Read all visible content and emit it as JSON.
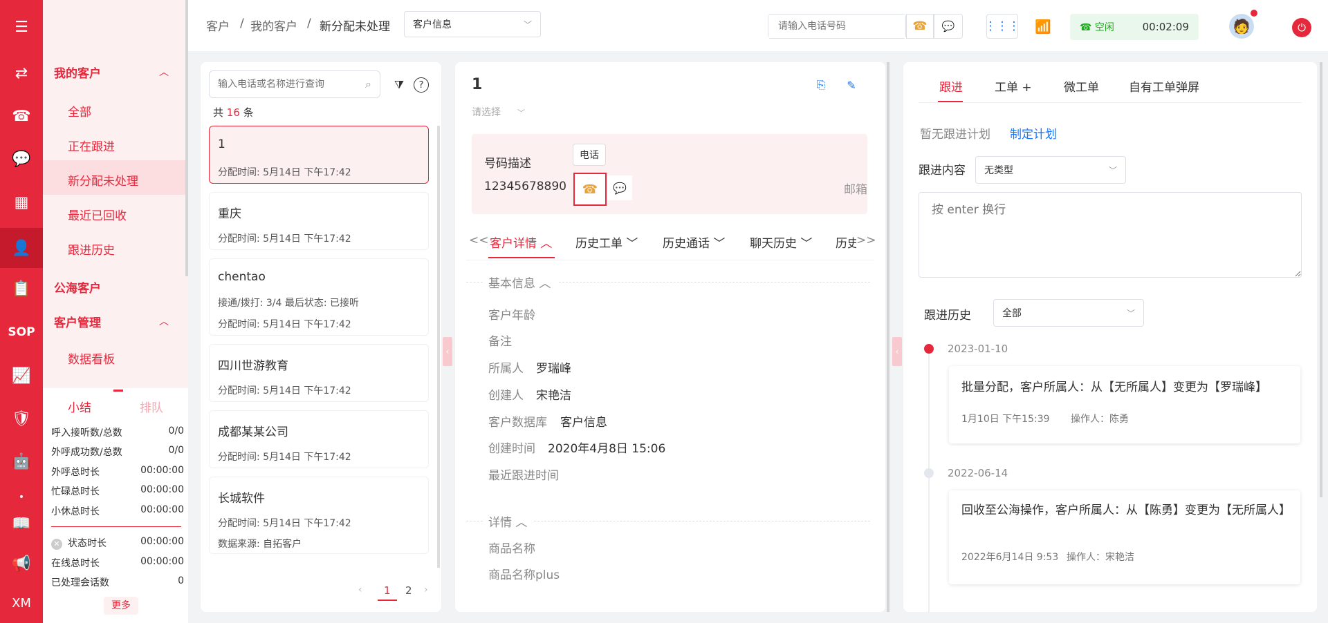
{
  "rail": {
    "items": [
      "menu-icon",
      "transfer-icon",
      "phone-icon",
      "chat-icon",
      "grid-icon",
      "user-icon",
      "clipboard-icon",
      "SOP",
      "monitor-icon",
      "shield-icon",
      "robot-icon",
      "dot",
      "book-icon",
      "megaphone-icon",
      "XM"
    ]
  },
  "sidebar": {
    "my_customers": "我的客户",
    "items": [
      "全部",
      "正在跟进",
      "新分配未处理",
      "最近已回收",
      "跟进历史"
    ],
    "public_customers": "公海客户",
    "customer_mgmt": "客户管理",
    "mgmt_items": [
      "数据看板"
    ]
  },
  "stats": {
    "tab_summary": "小结",
    "tab_queue": "排队",
    "rows": [
      [
        "呼入接听数/总数",
        "0/0"
      ],
      [
        "外呼成功数/总数",
        "0/0"
      ],
      [
        "外呼总时长",
        "00:00:00"
      ],
      [
        "忙碌总时长",
        "00:00:00"
      ],
      [
        "小休总时长",
        "00:00:00"
      ],
      [
        "状态时长",
        "00:00:00"
      ],
      [
        "在线总时长",
        "00:00:00"
      ],
      [
        "已处理会话数",
        "0"
      ]
    ],
    "more": "更多"
  },
  "header": {
    "crumbs": [
      "客户",
      "我的客户",
      "新分配未处理"
    ],
    "sep": "/",
    "db_select": "客户信息",
    "phone_placeholder": "请输入电话号码",
    "status": "空闲",
    "timer": "00:02:09"
  },
  "list": {
    "search_placeholder": "输入电话或名称进行查询",
    "total_prefix": "共",
    "total": "16",
    "total_suffix": "条",
    "cards": [
      {
        "title": "1",
        "metas": [
          "分配时间:  5月14日 下午17:42"
        ]
      },
      {
        "title": "重庆",
        "metas": [
          "分配时间:  5月14日 下午17:42"
        ]
      },
      {
        "title": "chentao",
        "metas": [
          "接通/拨打:  3/4    最后状态:  已接听",
          "分配时间:  5月14日 下午17:42"
        ]
      },
      {
        "title": "四川世游教育",
        "metas": [
          "分配时间:  5月14日 下午17:42"
        ]
      },
      {
        "title": "成都某某公司",
        "metas": [
          "分配时间:  5月14日 下午17:42"
        ]
      },
      {
        "title": "长城软件",
        "metas": [
          "分配时间:  5月14日 下午17:42",
          "数据来源:  自拓客户"
        ]
      }
    ],
    "pages": [
      "1",
      "2"
    ]
  },
  "detail": {
    "name": "1",
    "select_placeholder": "请选择",
    "phone_desc_label": "号码描述",
    "phone": "12345678890",
    "tooltip": "电话",
    "email_label": "邮箱",
    "tabs": [
      "客户详情",
      "历史工单",
      "历史通话",
      "聊天历史",
      "历史"
    ],
    "tab_prev": "<<",
    "tab_next": ">>",
    "basic_section": "基本信息",
    "fields": [
      {
        "label": "客户年龄",
        "value": ""
      },
      {
        "label": "备注",
        "value": ""
      },
      {
        "label": "所属人",
        "value": "罗瑞峰"
      },
      {
        "label": "创建人",
        "value": "宋艳洁"
      },
      {
        "label": "客户数据库",
        "value": "客户信息"
      },
      {
        "label": "创建时间",
        "value": "2020年4月8日 15:06"
      },
      {
        "label": "最近跟进时间",
        "value": ""
      }
    ],
    "detail_section": "详情",
    "detail_fields": [
      "商品名称",
      "商品名称plus"
    ]
  },
  "followup": {
    "tabs": [
      "跟进",
      "工单 +",
      "微工单",
      "自有工单弹屏"
    ],
    "no_plan": "暂无跟进计划",
    "make_plan": "制定计划",
    "content_label": "跟进内容",
    "content_type": "无类型",
    "textarea_placeholder": "按 enter 换行",
    "history_label": "跟进历史",
    "history_filter": "全部",
    "timeline": [
      {
        "date": "2023-01-10",
        "text": "批量分配，客户所属人：从【无所属人】变更为【罗瑞峰】",
        "time": "1月10日 下午15:39",
        "operator": "操作人：陈勇"
      },
      {
        "date": "2022-06-14",
        "text": "回收至公海操作，客户所属人：从【陈勇】变更为【无所属人】",
        "time": "2022年6月14日 9:53",
        "operator": "操作人：宋艳洁"
      }
    ]
  },
  "colors": {
    "accent": "#e5283c",
    "green": "#1aad19",
    "blue": "#1677ff"
  }
}
